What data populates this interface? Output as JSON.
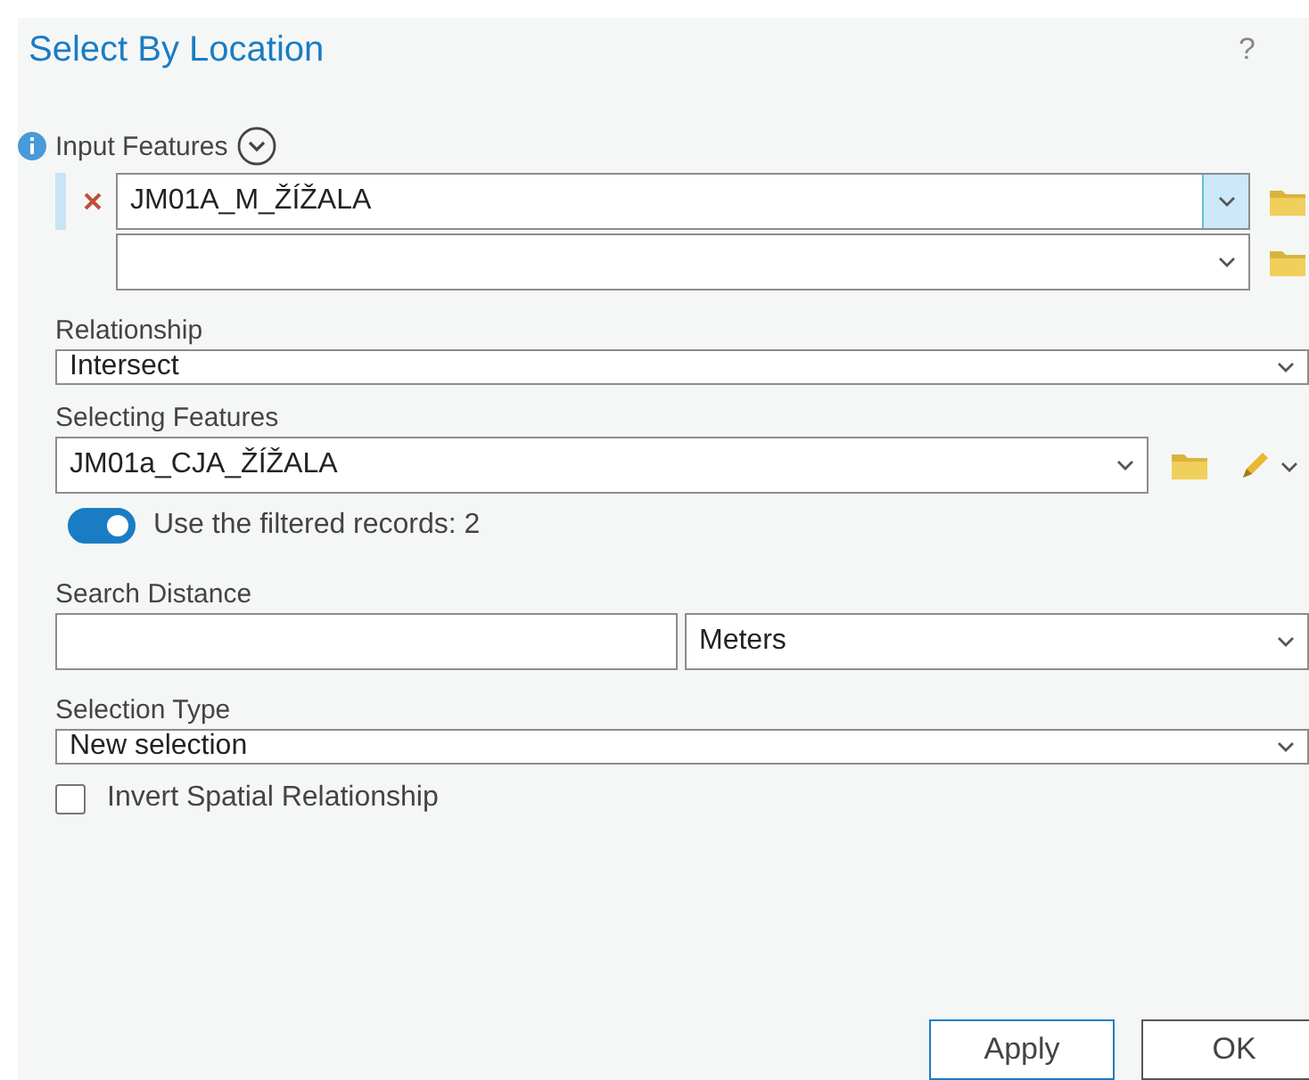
{
  "window": {
    "title": "Select By Location",
    "help": "?"
  },
  "input_features": {
    "label": "Input Features",
    "expanded": false,
    "rows": [
      {
        "value": "JM01A_M_ŽÍŽALA",
        "removable": true,
        "focused": true
      },
      {
        "removable": false,
        "focused": false
      }
    ]
  },
  "relationship": {
    "label": "Relationship",
    "value": "Intersect"
  },
  "selecting_features": {
    "label": "Selecting Features",
    "value": "JM01a_CJA_ŽÍŽALA"
  },
  "filtered_toggle": {
    "label": "Use the filtered records: 2",
    "on": true
  },
  "search_distance": {
    "label": "Search Distance",
    "unit": "Meters"
  },
  "selection_type": {
    "label": "Selection Type",
    "value": "New selection"
  },
  "invert": {
    "label": "Invert Spatial Relationship",
    "checked": false
  },
  "buttons": [
    {
      "label": "Apply",
      "primary": true
    },
    {
      "label": "OK",
      "primary": false
    }
  ]
}
